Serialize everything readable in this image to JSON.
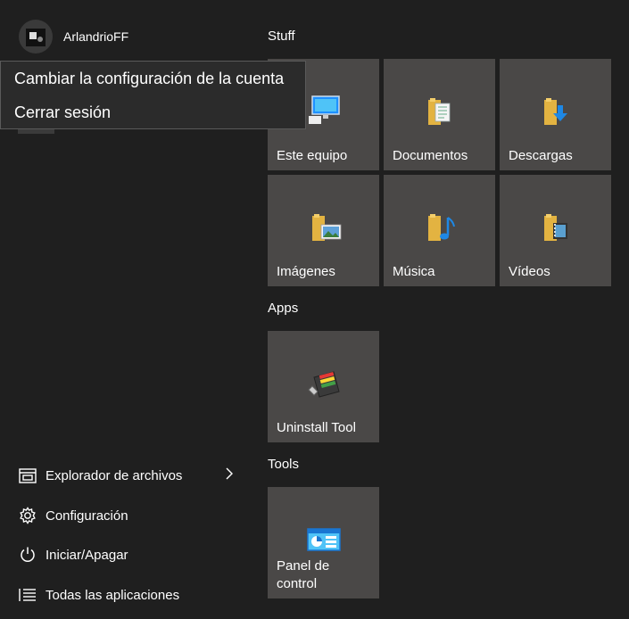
{
  "user": {
    "name": "ArlandrioFF"
  },
  "account_menu": {
    "items": [
      "Cambiar la configuración de la cuenta",
      "Cerrar sesión"
    ]
  },
  "nav": [
    {
      "label": "Explorador de archivos",
      "icon": "file-explorer-icon",
      "has_submenu": true
    },
    {
      "label": "Configuración",
      "icon": "gear-icon"
    },
    {
      "label": "Iniciar/Apagar",
      "icon": "power-icon"
    },
    {
      "label": "Todas las aplicaciones",
      "icon": "all-apps-list-icon"
    }
  ],
  "groups": [
    {
      "title": "Stuff",
      "tiles": [
        {
          "label": "Este equipo",
          "icon": "computer-icon"
        },
        {
          "label": "Documentos",
          "icon": "documents-folder-icon"
        },
        {
          "label": "Descargas",
          "icon": "downloads-folder-icon"
        },
        {
          "label": "Imágenes",
          "icon": "pictures-folder-icon"
        },
        {
          "label": "Música",
          "icon": "music-folder-icon"
        },
        {
          "label": "Vídeos",
          "icon": "videos-folder-icon"
        }
      ]
    },
    {
      "title": "Apps",
      "tiles": [
        {
          "label": "Uninstall Tool",
          "icon": "uninstall-tool-icon"
        }
      ]
    },
    {
      "title": "Tools",
      "tiles": [
        {
          "label": "Panel de control",
          "icon": "control-panel-icon"
        }
      ]
    }
  ],
  "colors": {
    "background": "#1f1f1f",
    "tile": "#4a4847",
    "popup": "#2b2b2b",
    "text": "#ffffff"
  }
}
